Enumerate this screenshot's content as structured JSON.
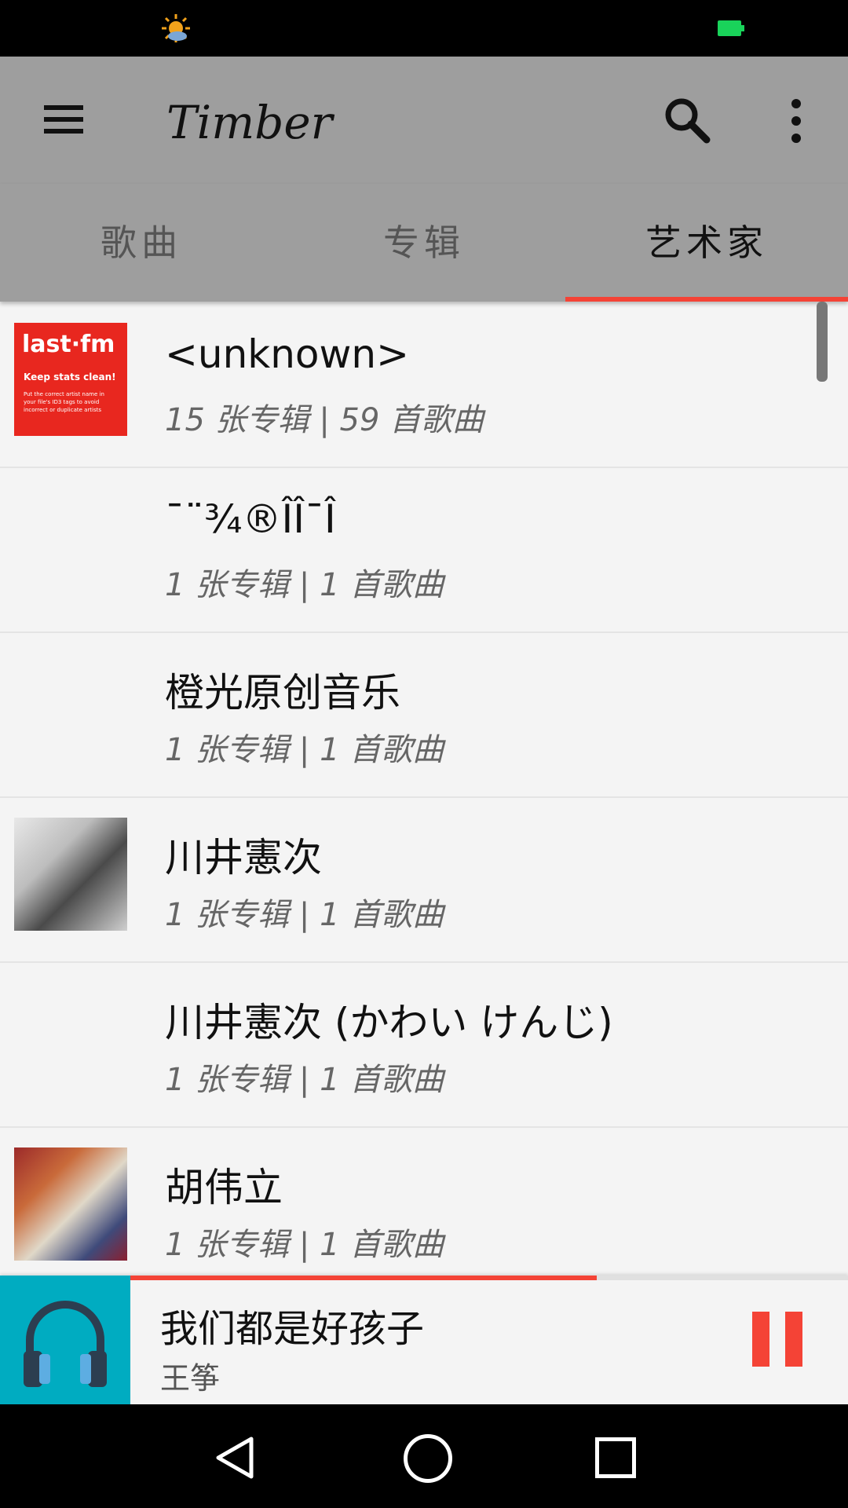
{
  "toolbar": {
    "title": "Timber",
    "icons": [
      "menu-icon",
      "search-icon",
      "more-vert-icon"
    ]
  },
  "tabs": [
    {
      "label": "歌曲",
      "active": false
    },
    {
      "label": "专辑",
      "active": false
    },
    {
      "label": "艺术家",
      "active": true
    }
  ],
  "artists": [
    {
      "name": "<unknown>",
      "meta": "15 张专辑 | 59 首歌曲",
      "thumb": {
        "logo": "last·fm",
        "line1": "Keep stats clean!",
        "line2": "Put the correct artist name in your file's ID3 tags to avoid incorrect or duplicate artists"
      }
    },
    {
      "name": "¯¨¾®ÎÎ¯Î",
      "meta": "1 张专辑 | 1 首歌曲"
    },
    {
      "name": "橙光原创音乐",
      "meta": "1 张专辑 | 1 首歌曲"
    },
    {
      "name": "川井憲次",
      "meta": "1 张专辑 | 1 首歌曲"
    },
    {
      "name": "川井憲次 (かわい けんじ)",
      "meta": "1 张专辑 | 1 首歌曲"
    },
    {
      "name": "胡伟立",
      "meta": "1 张专辑 | 1 首歌曲"
    }
  ],
  "now_playing": {
    "title": "我们都是好孩子",
    "artist": "王筝",
    "progress": 0.65,
    "accent_color": "#f44336",
    "art_color": "#00acc1"
  },
  "colors": {
    "toolbar": "#9e9e9e",
    "indicator": "#f44336"
  }
}
